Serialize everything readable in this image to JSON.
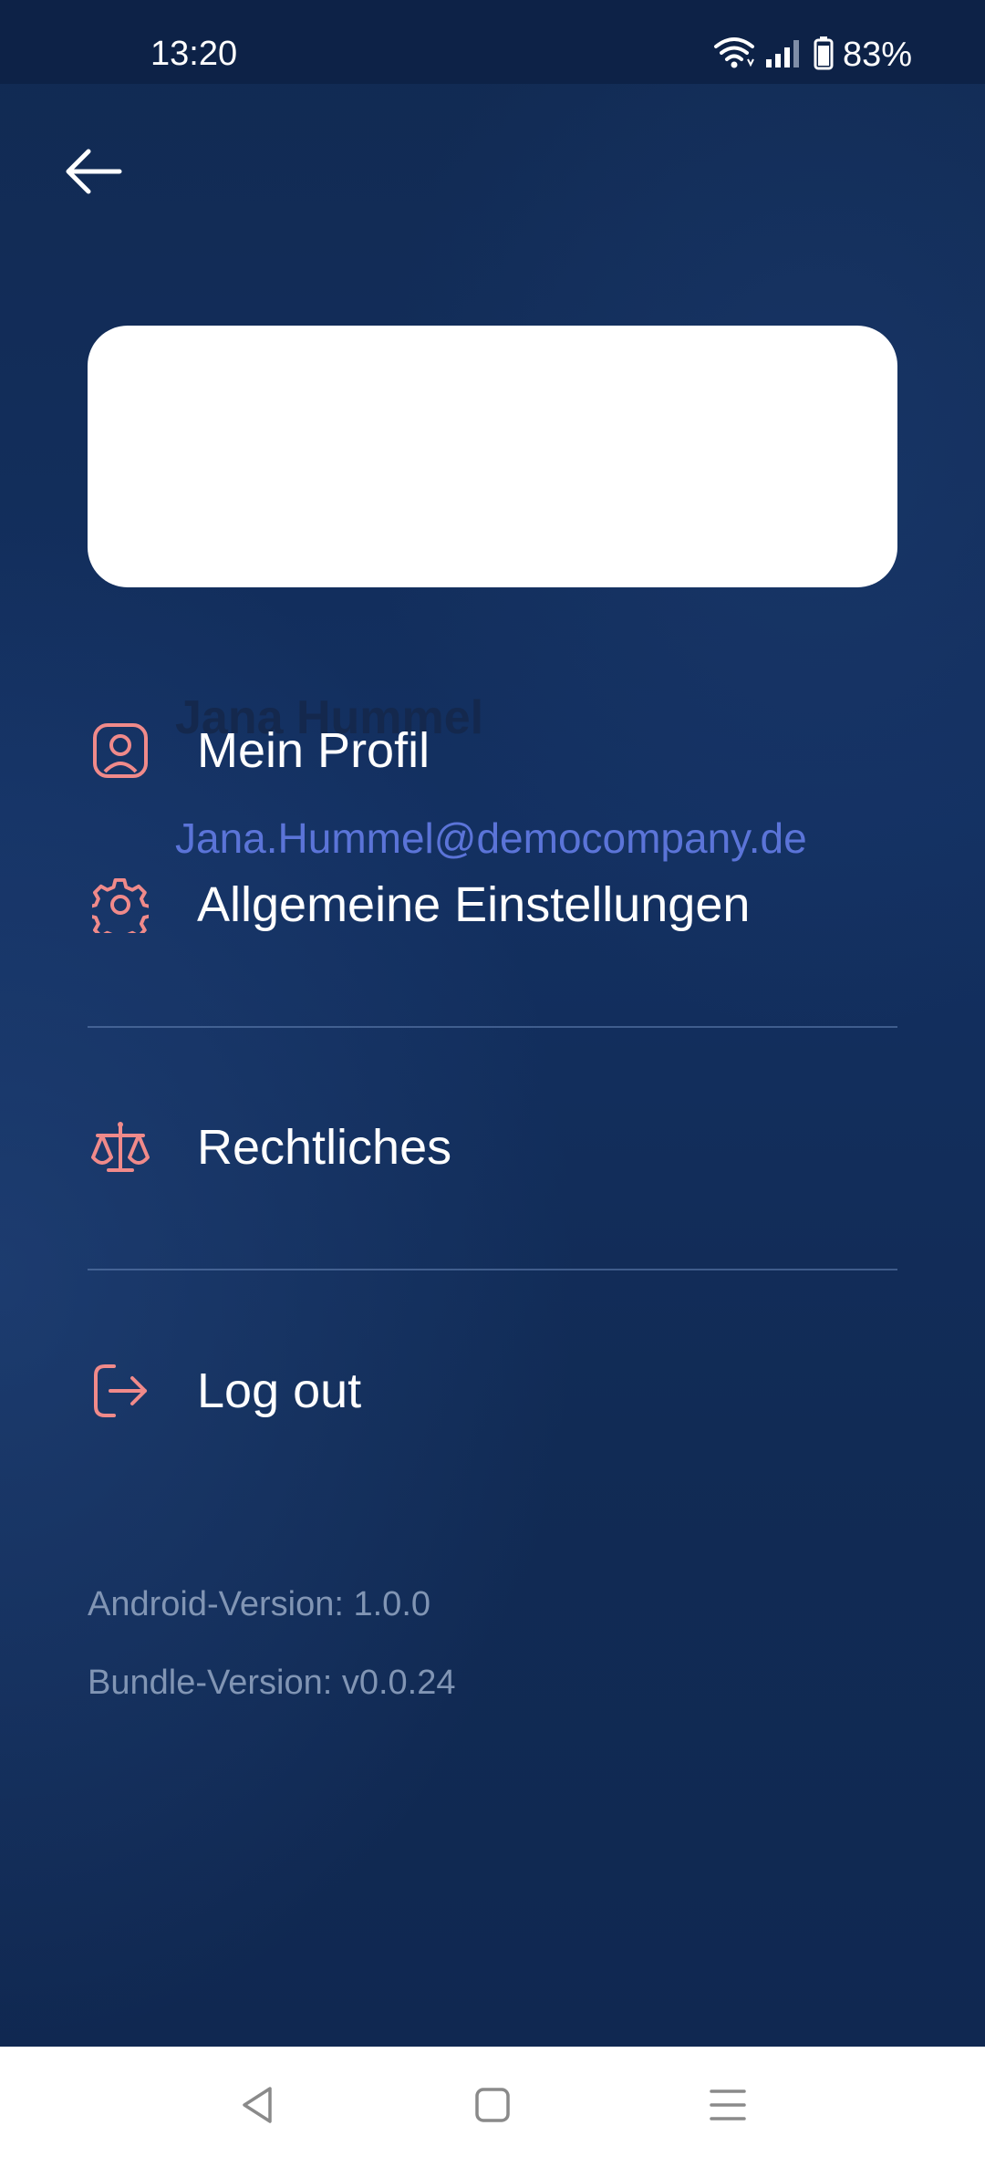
{
  "status_bar": {
    "time": "13:20",
    "battery": "83%",
    "icons": [
      "wifi-icon",
      "signal-icon",
      "battery-icon"
    ]
  },
  "header": {
    "back_icon": "arrow-left-icon"
  },
  "user": {
    "name": "Jana Hummel",
    "email": "Jana.Hummel@democompany.de"
  },
  "menu": {
    "items": [
      {
        "label": "Mein Profil",
        "icon": "profile-icon"
      },
      {
        "label": "Allgemeine Einstellungen",
        "icon": "gear-icon"
      },
      {
        "label": "Rechtliches",
        "icon": "scales-icon"
      },
      {
        "label": "Log out",
        "icon": "logout-icon"
      }
    ]
  },
  "versions": {
    "android": "Android-Version: 1.0.0",
    "bundle": "Bundle-Version: v0.0.24"
  },
  "colors": {
    "background": "#112b55",
    "accent_icon": "#f08a8a",
    "email": "#5b74d8",
    "card": "#ffffff",
    "name": "#14284d"
  },
  "nav_bar": {
    "buttons": [
      "back-triangle-icon",
      "home-square-icon",
      "menu-lines-icon"
    ]
  }
}
